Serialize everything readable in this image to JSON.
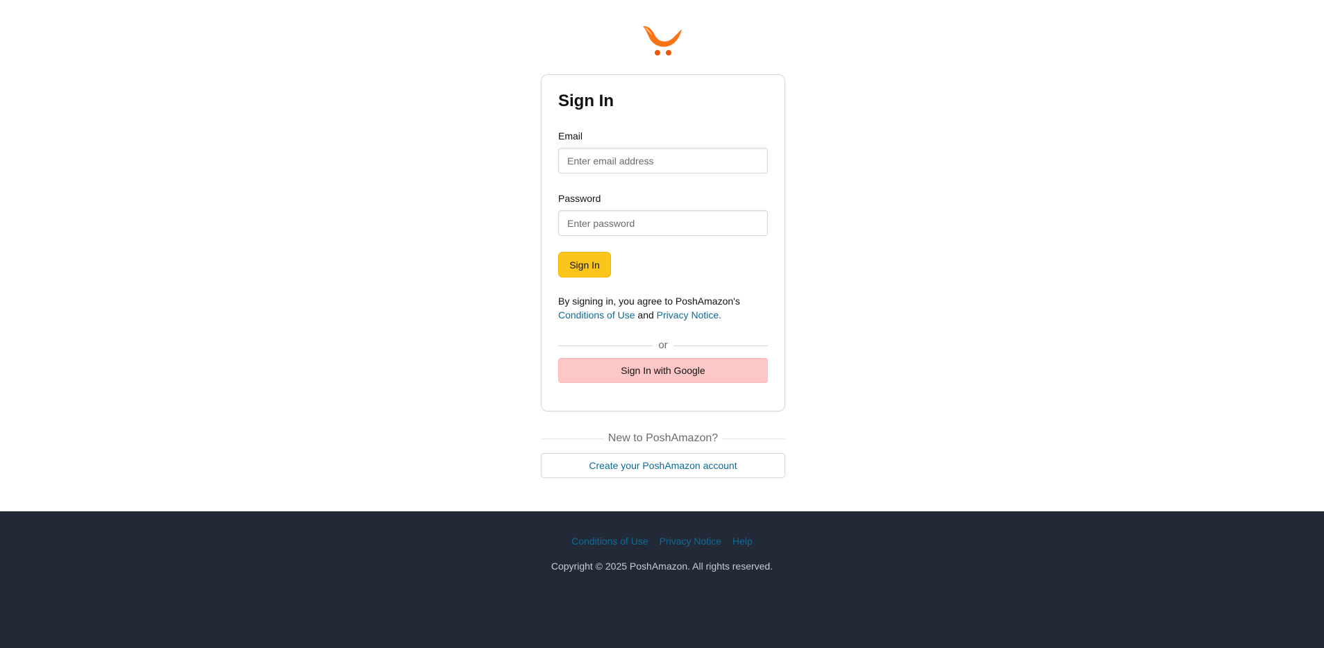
{
  "brand": {
    "logo_icon": "shopping-cart-swoosh-icon",
    "logo_colors": [
      "#f97316",
      "#fb923c",
      "#ea580c"
    ]
  },
  "signin_card": {
    "title": "Sign In",
    "email": {
      "label": "Email",
      "value": "",
      "placeholder": "Enter email address"
    },
    "password": {
      "label": "Password",
      "value": "",
      "placeholder": "Enter password"
    },
    "submit_label": "Sign In",
    "agreement": {
      "prefix": "By signing in, you agree to PoshAmazon's",
      "conditions_link": "Conditions of Use",
      "joiner": "and",
      "privacy_link": "Privacy Notice."
    },
    "divider_text": "or",
    "google_label": "Sign In with Google"
  },
  "new_account": {
    "divider_text": "New to PoshAmazon?",
    "create_label": "Create your PoshAmazon account"
  },
  "footer": {
    "links": [
      "Conditions of Use",
      "Privacy Notice",
      "Help"
    ],
    "copyright": "Copyright © 2025 PoshAmazon. All rights reserved."
  },
  "colors": {
    "primary_button": "#fbc51b",
    "google_button": "#fdc7c7",
    "link": "#0f6a96",
    "footer_bg": "#222a38"
  }
}
